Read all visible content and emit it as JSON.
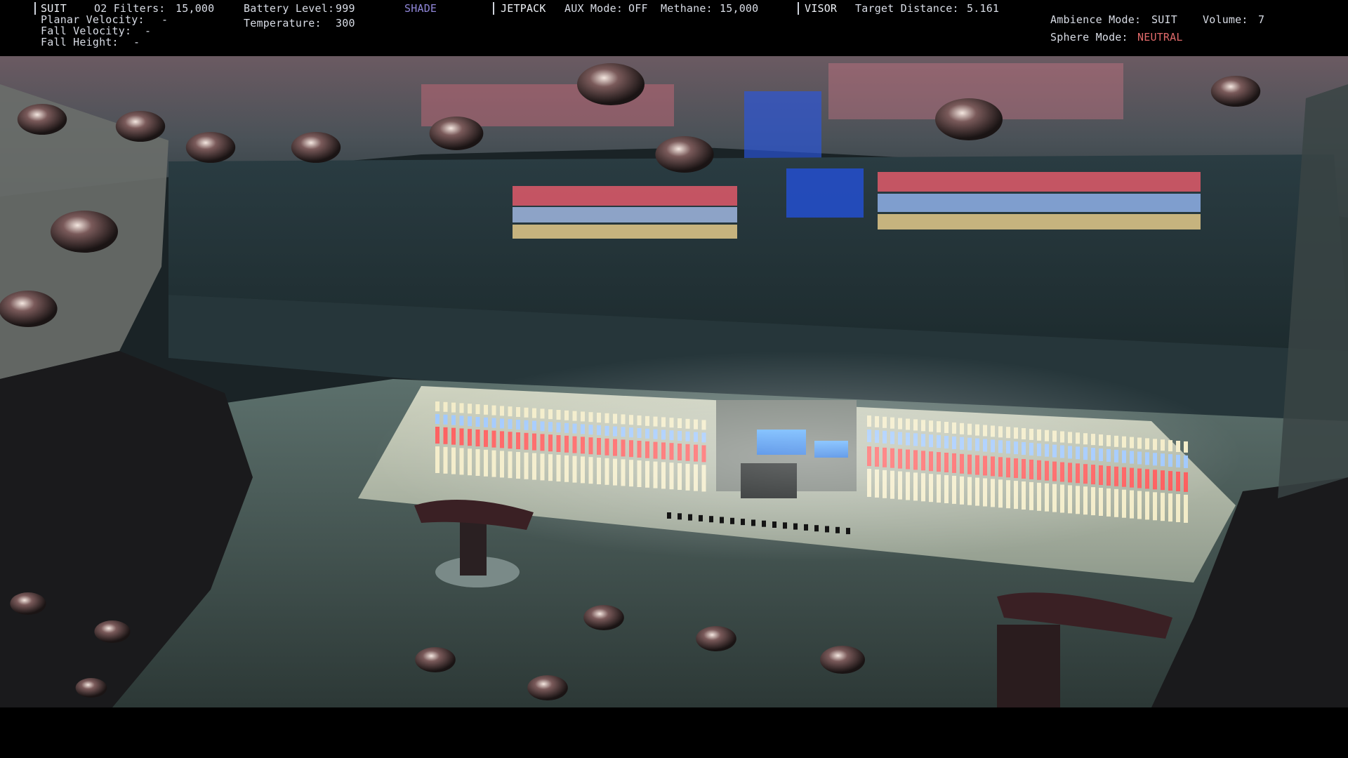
{
  "hud": {
    "suit": {
      "title": "SUIT",
      "o2_label": "O2 Filters:",
      "o2_value": "15,000",
      "planar_velocity_label": "Planar Velocity:",
      "planar_velocity_value": "-",
      "fall_velocity_label": "Fall Velocity:",
      "fall_velocity_value": "-",
      "fall_height_label": "Fall Height:",
      "fall_height_value": "-",
      "battery_label": "Battery Level:",
      "battery_value": "999",
      "temperature_label": "Temperature:",
      "temperature_value": "300",
      "shade_label": "SHADE"
    },
    "jetpack": {
      "title": "JETPACK",
      "aux_label": "AUX Mode:",
      "aux_value": "OFF",
      "methane_label": "Methane:",
      "methane_value": "15,000"
    },
    "visor": {
      "title": "VISOR",
      "target_distance_label": "Target Distance:",
      "target_distance_value": "5.161"
    },
    "ambience": {
      "mode_label": "Ambience Mode:",
      "mode_value": "SUIT",
      "volume_label": "Volume:",
      "volume_value": "7",
      "sphere_label": "Sphere Mode:",
      "sphere_value": "NEUTRAL"
    }
  },
  "colors": {
    "hud_text": "#cfd3dc",
    "shade_accent": "#8f86d8",
    "neutral_accent": "#e06a6a",
    "console_blue_screen": "#3a8ff0",
    "fader_red": "#ff5a5a",
    "fader_blue": "#9fc8ff",
    "fader_cream": "#f3ecc8"
  },
  "scene": {
    "description_icons": [
      "mixing-console",
      "joystick-left",
      "joystick-right",
      "ceiling-rivets"
    ]
  }
}
